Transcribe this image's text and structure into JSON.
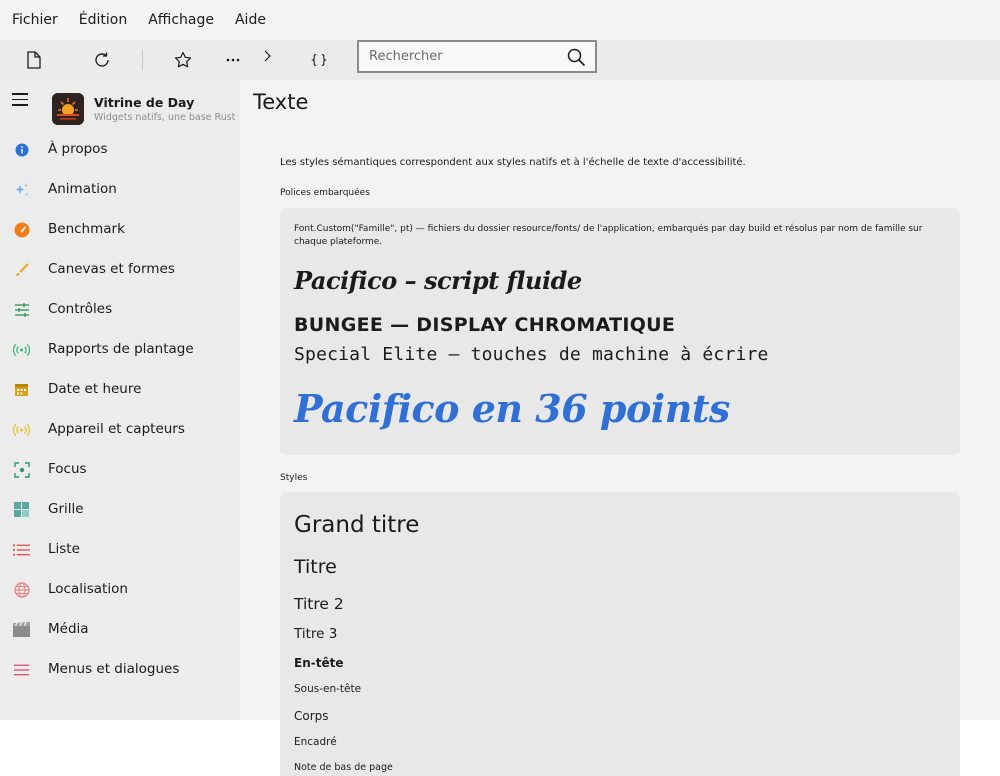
{
  "menu": [
    "Fichier",
    "Édition",
    "Affichage",
    "Aide"
  ],
  "toolbar": {
    "search_placeholder": "Rechercher",
    "icons": [
      "document-icon",
      "refresh-icon",
      "star-icon",
      "more-icon",
      "chevron-right-icon",
      "braces-icon",
      "search-icon"
    ]
  },
  "app": {
    "title": "Vitrine de Day",
    "subtitle": "Widgets natifs, une base Rust"
  },
  "sidebar": {
    "items": [
      {
        "label": "À propos",
        "icon": "info-icon",
        "color": "#2f6fd6"
      },
      {
        "label": "Animation",
        "icon": "sparkle-icon",
        "color": "#7ab0e8"
      },
      {
        "label": "Benchmark",
        "icon": "gauge-icon",
        "color": "#f07d1a"
      },
      {
        "label": "Canevas et formes",
        "icon": "brush-icon",
        "color": "#f0a030"
      },
      {
        "label": "Contrôles",
        "icon": "sliders-icon",
        "color": "#3a9a5a"
      },
      {
        "label": "Rapports de plantage",
        "icon": "broadcast-icon",
        "color": "#3cb371"
      },
      {
        "label": "Date et heure",
        "icon": "calendar-icon",
        "color": "#d4a017"
      },
      {
        "label": "Appareil et capteurs",
        "icon": "sensor-icon",
        "color": "#e8c020"
      },
      {
        "label": "Focus",
        "icon": "focus-icon",
        "color": "#2a9a7a"
      },
      {
        "label": "Grille",
        "icon": "grid-icon",
        "color": "#5aa9a0"
      },
      {
        "label": "Liste",
        "icon": "list-icon",
        "color": "#e05050"
      },
      {
        "label": "Localisation",
        "icon": "globe-icon",
        "color": "#e88080"
      },
      {
        "label": "Média",
        "icon": "clapper-icon",
        "color": "#8a8a8a"
      },
      {
        "label": "Menus et dialogues",
        "icon": "menu-icon",
        "color": "#d85a7a"
      }
    ]
  },
  "main": {
    "title": "Texte",
    "intro": "Les styles sémantiques correspondent aux styles natifs et à l'échelle de texte d'accessibilité.",
    "embedded": {
      "label": "Polices embarquées",
      "description": "Font.Custom(\"Famille\", pt) — fichiers du dossier resource/fonts/ de l'application, embarqués par day build et résolus par nom de famille sur chaque plateforme.",
      "pacifico": "Pacifico – script fluide",
      "bungee": "BUNGEE — DISPLAY CHROMATIQUE",
      "special_elite": "Special Elite — touches de machine à écrire",
      "pacifico36": "Pacifico en 36 points",
      "pacifico36_color": "#2f6fd6"
    },
    "styles": {
      "label": "Styles",
      "large_title": "Grand titre",
      "title": "Titre",
      "title2": "Titre 2",
      "title3": "Titre 3",
      "headline": "En-tête",
      "subheadline": "Sous-en-tête",
      "body": "Corps",
      "callout": "Encadré",
      "footnote": "Note de bas de page"
    }
  }
}
